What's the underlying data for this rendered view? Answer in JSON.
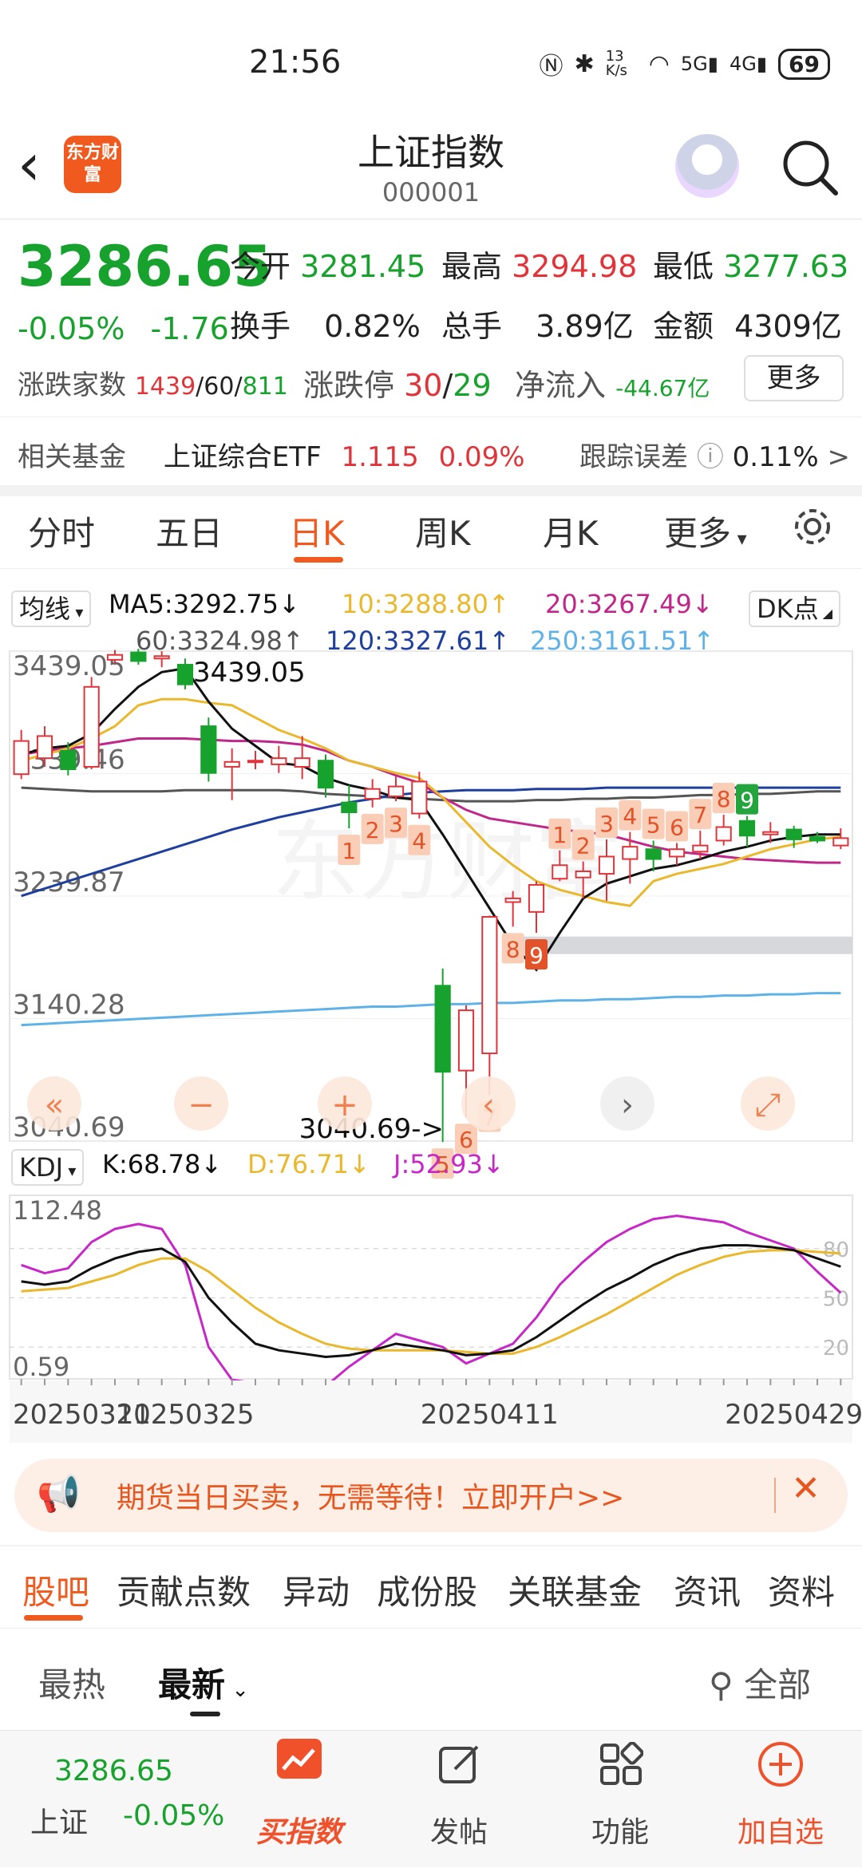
{
  "status": {
    "time": "21:56",
    "speed": "13 K/s",
    "battery": "69"
  },
  "header": {
    "logo": "东方财富",
    "title": "上证指数",
    "code": "000001"
  },
  "quote": {
    "price": "3286.65",
    "change_pct": "-0.05%",
    "change": "-1.76",
    "open_label": "今开",
    "open": "3281.45",
    "high_label": "最高",
    "high": "3294.98",
    "low_label": "最低",
    "low": "3277.63",
    "turnover_label": "换手",
    "turnover": "0.82%",
    "volume_label": "总手",
    "volume": "3.89亿",
    "amount_label": "金额",
    "amount": "4309亿",
    "breadth_label": "涨跌家数",
    "up": "1439",
    "flat": "60",
    "down": "811",
    "limit_label": "涨跌停",
    "limit_up": "30",
    "limit_down": "29",
    "flow_label": "净流入",
    "flow": "-44.67亿",
    "more": "更多"
  },
  "fund": {
    "label": "相关基金",
    "name": "上证综合ETF",
    "price": "1.115",
    "pct": "0.09%",
    "err_label": "跟踪误差",
    "err": "0.11%"
  },
  "tabs": [
    "分时",
    "五日",
    "日K",
    "周K",
    "月K",
    "更多",
    ""
  ],
  "ma": {
    "selector": "均线",
    "ma5": "MA5:3292.75↓",
    "ma10": "10:3288.80↑",
    "ma20": "20:3267.49↓",
    "ma60": "60:3324.98↑",
    "ma120": "120:3327.61↑",
    "ma250": "250:3161.51↑",
    "dk": "DK点"
  },
  "price_axis": [
    "3439.05",
    "3339.46",
    "3239.87",
    "3140.28",
    "3040.69"
  ],
  "annotations": {
    "high": "3439.05",
    "low": "3040.69->"
  },
  "kdj": {
    "selector": "KDJ",
    "k": "K:68.78↓",
    "d": "D:76.71↓",
    "j": "J:52.93↓",
    "top": "112.48",
    "bottom": "0.59",
    "l80": "80",
    "l50": "50",
    "l20": "20"
  },
  "dates": [
    "20250311",
    "20250325",
    "20250411",
    "20250429"
  ],
  "colors": {
    "up": "#e0343a",
    "down": "#16a22c",
    "ma5": "#111111",
    "ma10": "#e9b82c",
    "ma20": "#c0278a",
    "ma60": "#555555",
    "ma120": "#1f3f9e",
    "ma250": "#5fb2e8",
    "accent": "#f05a1e"
  },
  "chart_data": {
    "type": "candlestick",
    "candles": [
      {
        "o": 3339,
        "c": 3366,
        "h": 3375,
        "l": 3335
      },
      {
        "o": 3352,
        "c": 3370,
        "h": 3378,
        "l": 3345
      },
      {
        "o": 3358,
        "c": 3343,
        "h": 3365,
        "l": 3338
      },
      {
        "o": 3345,
        "c": 3410,
        "h": 3418,
        "l": 3343
      },
      {
        "o": 3432,
        "c": 3436,
        "h": 3440,
        "l": 3428
      },
      {
        "o": 3438,
        "c": 3431,
        "h": 3441,
        "l": 3428
      },
      {
        "o": 3433,
        "c": 3435,
        "h": 3439,
        "l": 3426
      },
      {
        "o": 3428,
        "c": 3412,
        "h": 3433,
        "l": 3408
      },
      {
        "o": 3378,
        "c": 3340,
        "h": 3385,
        "l": 3333
      },
      {
        "o": 3345,
        "c": 3349,
        "h": 3360,
        "l": 3318
      },
      {
        "o": 3350,
        "c": 3350,
        "h": 3358,
        "l": 3343
      },
      {
        "o": 3347,
        "c": 3352,
        "h": 3362,
        "l": 3340
      },
      {
        "o": 3345,
        "c": 3352,
        "h": 3370,
        "l": 3335
      },
      {
        "o": 3350,
        "c": 3328,
        "h": 3355,
        "l": 3320
      },
      {
        "o": 3316,
        "c": 3308,
        "h": 3330,
        "l": 3295
      },
      {
        "o": 3319,
        "c": 3327,
        "h": 3335,
        "l": 3312
      },
      {
        "o": 3321,
        "c": 3329,
        "h": 3337,
        "l": 3317
      },
      {
        "o": 3307,
        "c": 3333,
        "h": 3341,
        "l": 3303
      },
      {
        "o": 3167,
        "c": 3097,
        "h": 3181,
        "l": 3040
      },
      {
        "o": 3098,
        "c": 3147,
        "h": 3151,
        "l": 3060
      },
      {
        "o": 3112,
        "c": 3223,
        "h": 3224,
        "l": 3078
      },
      {
        "o": 3235,
        "c": 3238,
        "h": 3244,
        "l": 3215
      },
      {
        "o": 3227,
        "c": 3249,
        "h": 3252,
        "l": 3210
      },
      {
        "o": 3254,
        "c": 3265,
        "h": 3277,
        "l": 3252
      },
      {
        "o": 3255,
        "c": 3260,
        "h": 3268,
        "l": 3238
      },
      {
        "o": 3258,
        "c": 3272,
        "h": 3286,
        "l": 3236
      },
      {
        "o": 3270,
        "c": 3280,
        "h": 3292,
        "l": 3250
      },
      {
        "o": 3278,
        "c": 3270,
        "h": 3285,
        "l": 3260
      },
      {
        "o": 3272,
        "c": 3278,
        "h": 3283,
        "l": 3265
      },
      {
        "o": 3276,
        "c": 3281,
        "h": 3293,
        "l": 3270
      },
      {
        "o": 3285,
        "c": 3296,
        "h": 3306,
        "l": 3281
      },
      {
        "o": 3301,
        "c": 3289,
        "h": 3305,
        "l": 3280
      },
      {
        "o": 3290,
        "c": 3292,
        "h": 3300,
        "l": 3283
      },
      {
        "o": 3294,
        "c": 3286,
        "h": 3297,
        "l": 3279
      },
      {
        "o": 3288,
        "c": 3285,
        "h": 3292,
        "l": 3283
      },
      {
        "o": 3281,
        "c": 3287,
        "h": 3295,
        "l": 3278
      }
    ],
    "ma5": [
      3355,
      3360,
      3362,
      3372,
      3392,
      3410,
      3422,
      3425,
      3398,
      3376,
      3362,
      3348,
      3346,
      3336,
      3330,
      3326,
      3320,
      3318,
      3290,
      3260,
      3230,
      3200,
      3180,
      3210,
      3238,
      3250,
      3256,
      3262,
      3265,
      3270,
      3276,
      3280,
      3285,
      3288,
      3290,
      3290
    ],
    "ma10": [
      3350,
      3355,
      3360,
      3368,
      3378,
      3395,
      3400,
      3400,
      3397,
      3395,
      3385,
      3375,
      3368,
      3360,
      3350,
      3345,
      3340,
      3336,
      3320,
      3300,
      3280,
      3265,
      3252,
      3245,
      3240,
      3235,
      3232,
      3252,
      3258,
      3262,
      3266,
      3272,
      3278,
      3282,
      3286,
      3288
    ],
    "ma20": [
      3355,
      3358,
      3360,
      3362,
      3365,
      3368,
      3368,
      3368,
      3367,
      3366,
      3366,
      3365,
      3363,
      3358,
      3350,
      3345,
      3338,
      3332,
      3320,
      3310,
      3303,
      3300,
      3297,
      3294,
      3292,
      3290,
      3285,
      3280,
      3276,
      3274,
      3272,
      3270,
      3269,
      3268,
      3267,
      3267
    ],
    "ma60": [
      3328,
      3327,
      3326,
      3325,
      3325,
      3325,
      3325,
      3326,
      3326,
      3326,
      3326,
      3326,
      3325,
      3323,
      3322,
      3321,
      3320,
      3319,
      3318,
      3317,
      3317,
      3317,
      3318,
      3318,
      3319,
      3319,
      3320,
      3320,
      3321,
      3322,
      3322,
      3323,
      3323,
      3324,
      3325,
      3325
    ],
    "ma120": [
      3240,
      3246,
      3252,
      3258,
      3264,
      3270,
      3276,
      3282,
      3288,
      3294,
      3299,
      3304,
      3308,
      3312,
      3316,
      3319,
      3322,
      3324,
      3325,
      3326,
      3326,
      3326,
      3327,
      3327,
      3327,
      3328,
      3328,
      3328,
      3328,
      3328,
      3328,
      3328,
      3328,
      3328,
      3328,
      3328
    ],
    "ma250": [
      3135,
      3136,
      3137,
      3138,
      3139,
      3140,
      3141,
      3142,
      3143,
      3144,
      3145,
      3146,
      3147,
      3148,
      3149,
      3150,
      3150,
      3151,
      3152,
      3152,
      3153,
      3153,
      3154,
      3155,
      3155,
      3156,
      3156,
      3157,
      3158,
      3158,
      3159,
      3159,
      3160,
      3160,
      3161,
      3161
    ],
    "td_labels": [
      {
        "i": 14,
        "t": "1"
      },
      {
        "i": 15,
        "t": "2"
      },
      {
        "i": 16,
        "t": "3"
      },
      {
        "i": 17,
        "t": "4"
      },
      {
        "i": 18,
        "t": "5"
      },
      {
        "i": 19,
        "t": "6"
      },
      {
        "i": 20,
        "t": "7"
      },
      {
        "i": 21,
        "t": "8"
      },
      {
        "i": 22,
        "t": "9"
      },
      {
        "i": 23,
        "t": "1"
      },
      {
        "i": 24,
        "t": "2"
      },
      {
        "i": 25,
        "t": "3"
      },
      {
        "i": 26,
        "t": "4"
      },
      {
        "i": 27,
        "t": "5"
      },
      {
        "i": 28,
        "t": "6"
      },
      {
        "i": 29,
        "t": "7"
      },
      {
        "i": 30,
        "t": "8"
      },
      {
        "i": 31,
        "t": "9"
      }
    ],
    "kdj_k": [
      60,
      58,
      60,
      68,
      74,
      78,
      80,
      72,
      50,
      35,
      22,
      18,
      16,
      14,
      15,
      18,
      22,
      20,
      18,
      15,
      16,
      18,
      26,
      36,
      46,
      55,
      62,
      70,
      76,
      80,
      82,
      82,
      81,
      79,
      74,
      69
    ],
    "kdj_d": [
      54,
      55,
      56,
      60,
      64,
      70,
      74,
      74,
      66,
      55,
      44,
      35,
      28,
      22,
      19,
      18,
      18,
      18,
      18,
      17,
      16,
      16,
      20,
      26,
      33,
      40,
      48,
      56,
      64,
      70,
      75,
      78,
      79,
      79,
      78,
      77
    ],
    "kdj_j": [
      70,
      65,
      68,
      84,
      92,
      95,
      92,
      70,
      20,
      0,
      -2,
      -5,
      -8,
      -4,
      8,
      18,
      28,
      24,
      20,
      10,
      16,
      22,
      38,
      58,
      72,
      84,
      92,
      98,
      100,
      98,
      96,
      90,
      85,
      80,
      66,
      53
    ]
  },
  "promo": {
    "text": "期货当日买卖，无需等待！立即开户>>"
  },
  "bottom_tabs": [
    "股吧",
    "贡献点数",
    "异动",
    "成份股",
    "关联基金",
    "资讯",
    "资料"
  ],
  "feed_tabs": {
    "hot": "最热",
    "new": "最新",
    "all": "全部"
  },
  "nav": {
    "index_price": "3286.65",
    "index_name": "上证",
    "index_pct": "-0.05%",
    "buy": "买指数",
    "post": "发帖",
    "func": "功能",
    "add": "加自选"
  }
}
